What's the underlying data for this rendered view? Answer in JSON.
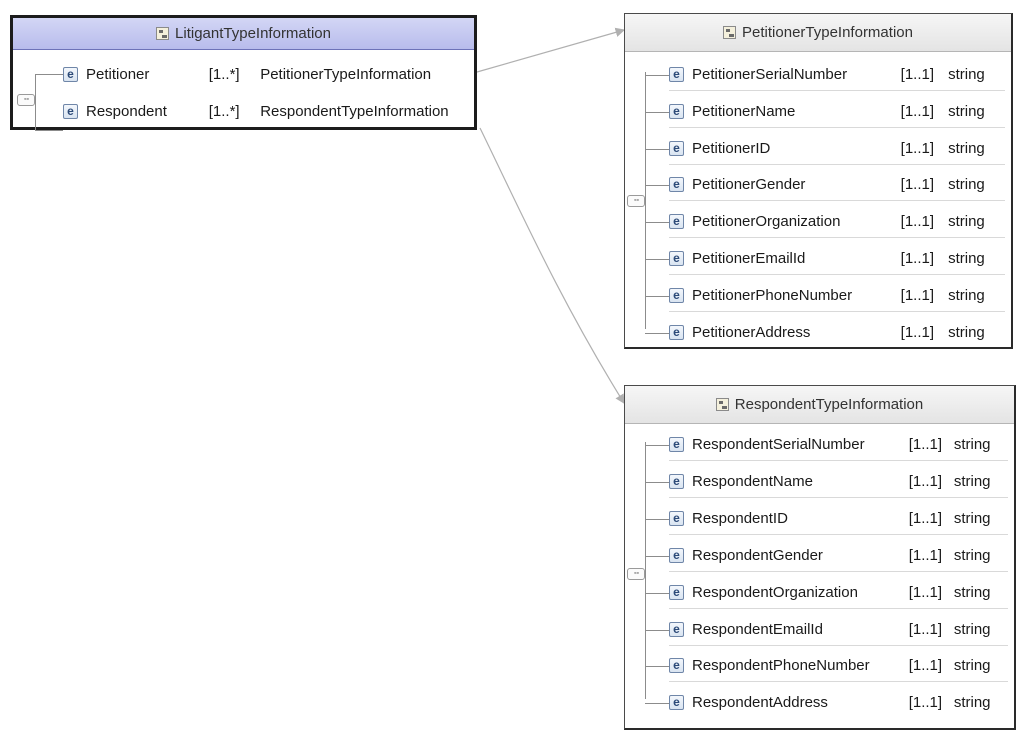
{
  "element_icon_label": "e",
  "sequence_icon_label": "▫▫▫",
  "colors": {
    "selected_header": "#c6c9f1",
    "connector": "#b0b0b0",
    "border": "#1c1c1c"
  },
  "litigant": {
    "title": "LitigantTypeInformation",
    "rows": [
      {
        "name": "Petitioner",
        "cardinality": "[1..*]",
        "type": "PetitionerTypeInformation"
      },
      {
        "name": "Respondent",
        "cardinality": "[1..*]",
        "type": "RespondentTypeInformation"
      }
    ]
  },
  "petitioner": {
    "title": "PetitionerTypeInformation",
    "rows": [
      {
        "name": "PetitionerSerialNumber",
        "cardinality": "[1..1]",
        "type": "string"
      },
      {
        "name": "PetitionerName",
        "cardinality": "[1..1]",
        "type": "string"
      },
      {
        "name": "PetitionerID",
        "cardinality": "[1..1]",
        "type": "string"
      },
      {
        "name": "PetitionerGender",
        "cardinality": "[1..1]",
        "type": "string"
      },
      {
        "name": "PetitionerOrganization",
        "cardinality": "[1..1]",
        "type": "string"
      },
      {
        "name": "PetitionerEmailId",
        "cardinality": "[1..1]",
        "type": "string"
      },
      {
        "name": "PetitionerPhoneNumber",
        "cardinality": "[1..1]",
        "type": "string"
      },
      {
        "name": "PetitionerAddress",
        "cardinality": "[1..1]",
        "type": "string"
      }
    ]
  },
  "respondent": {
    "title": "RespondentTypeInformation",
    "rows": [
      {
        "name": "RespondentSerialNumber",
        "cardinality": "[1..1]",
        "type": "string"
      },
      {
        "name": "RespondentName",
        "cardinality": "[1..1]",
        "type": "string"
      },
      {
        "name": "RespondentID",
        "cardinality": "[1..1]",
        "type": "string"
      },
      {
        "name": "RespondentGender",
        "cardinality": "[1..1]",
        "type": "string"
      },
      {
        "name": "RespondentOrganization",
        "cardinality": "[1..1]",
        "type": "string"
      },
      {
        "name": "RespondentEmailId",
        "cardinality": "[1..1]",
        "type": "string"
      },
      {
        "name": "RespondentPhoneNumber",
        "cardinality": "[1..1]",
        "type": "string"
      },
      {
        "name": "RespondentAddress",
        "cardinality": "[1..1]",
        "type": "string"
      }
    ]
  }
}
